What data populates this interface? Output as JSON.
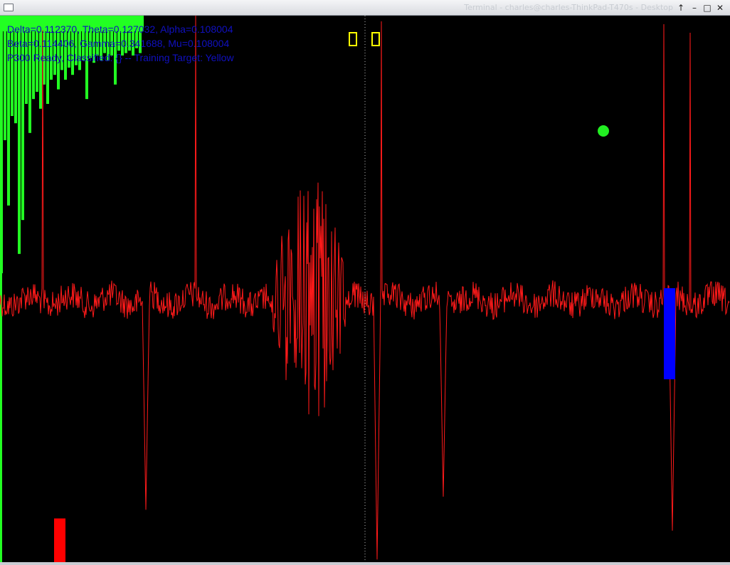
{
  "window": {
    "title": "Terminal - charles@charles-ThinkPad-T470s - Desktop",
    "buttons": {
      "up": "↑",
      "minimize": "–",
      "maximize": "□",
      "close": "✕"
    }
  },
  "status": {
    "line1": "Delta=0.112370, Theta=0.127032, Alpha=0.108004",
    "line2": "Beta=0.114406, Gamma=0.341688, Mu=0.108004",
    "line3": "P300 Ready, Classified: {} -- Training Target: Yellow"
  },
  "colors": {
    "background": "#000000",
    "signal": "#ff1a1a",
    "spectrum": "#22ff22",
    "text": "#1010c0",
    "target_box": "#ffff00",
    "marker": "#0000ff",
    "dot": "#22ee22"
  },
  "eeg": {
    "baseline": 0.0,
    "spikes": [
      {
        "index": 60,
        "value": 0.95
      },
      {
        "index": 275,
        "value": 1.0
      },
      {
        "index": 536,
        "value": 0.98
      },
      {
        "index": 933,
        "value": 0.97
      },
      {
        "index": 970,
        "value": 0.94
      }
    ],
    "burst_range": [
      375,
      495
    ],
    "dips": [
      {
        "index": 205,
        "value": -0.8
      },
      {
        "index": 530,
        "value": -0.99
      },
      {
        "index": 623,
        "value": -0.75
      },
      {
        "index": 945,
        "value": -0.88
      }
    ]
  },
  "spectrum_bars": [
    1.0,
    0.45,
    0.72,
    0.35,
    0.38,
    0.92,
    0.78,
    0.3,
    0.42,
    0.28,
    0.25,
    0.32,
    0.22,
    0.3,
    0.2,
    0.18,
    0.24,
    0.16,
    0.2,
    0.15,
    0.18,
    0.14,
    0.16,
    0.12,
    0.28,
    0.11,
    0.13,
    0.1,
    0.12,
    0.09,
    0.12,
    0.1,
    0.22,
    0.08,
    0.1,
    0.09,
    0.08,
    0.1,
    0.07,
    0.09
  ],
  "targets": [
    {
      "label": "target-box-1"
    },
    {
      "label": "target-box-2"
    }
  ],
  "p300_marker_level": 0.42,
  "signal_level_bar": 0.08,
  "dot": {
    "label": "classifier-dot"
  }
}
